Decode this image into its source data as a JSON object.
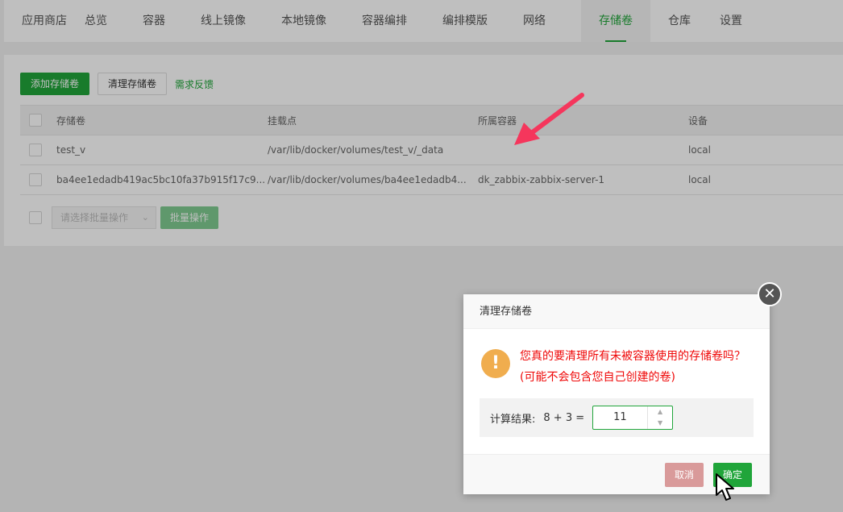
{
  "colors": {
    "accent": "#20a53a",
    "warning_text": "#ef0808",
    "warning_icon": "#f0ad4e",
    "annotation_arrow": "#f5365c"
  },
  "nav": {
    "tabs": [
      {
        "label": "应用商店"
      },
      {
        "label": "总览"
      },
      {
        "label": "容器"
      },
      {
        "label": "线上镜像"
      },
      {
        "label": "本地镜像"
      },
      {
        "label": "容器编排"
      },
      {
        "label": "编排模版"
      },
      {
        "label": "网络"
      },
      {
        "label": "存储卷",
        "active": true
      },
      {
        "label": "仓库"
      },
      {
        "label": "设置"
      }
    ]
  },
  "toolbar": {
    "add_label": "添加存储卷",
    "prune_label": "清理存储卷",
    "feedback_label": "需求反馈"
  },
  "table": {
    "headers": [
      "存储卷",
      "挂载点",
      "所属容器",
      "设备"
    ],
    "rows": [
      {
        "volume": "test_v",
        "mountpoint": "/var/lib/docker/volumes/test_v/_data",
        "container": "",
        "driver": "local"
      },
      {
        "volume": "ba4ee1edadb419ac5bc10fa37b915f17c9...",
        "mountpoint": "/var/lib/docker/volumes/ba4ee1edadb4...",
        "container": "dk_zabbix-zabbix-server-1",
        "driver": "local"
      }
    ]
  },
  "batch": {
    "select_placeholder": "请选择批量操作",
    "button_label": "批量操作"
  },
  "dialog": {
    "title": "清理存储卷",
    "warning_icon_glyph": "!",
    "message": "您真的要清理所有未被容器使用的存储卷吗？ (可能不会包含您自己创建的卷)",
    "calc_label": "计算结果:",
    "calc_expr": "8 + 3  =",
    "calc_value": "11",
    "cancel_label": "取消",
    "ok_label": "确定",
    "close_glyph": "✕"
  }
}
